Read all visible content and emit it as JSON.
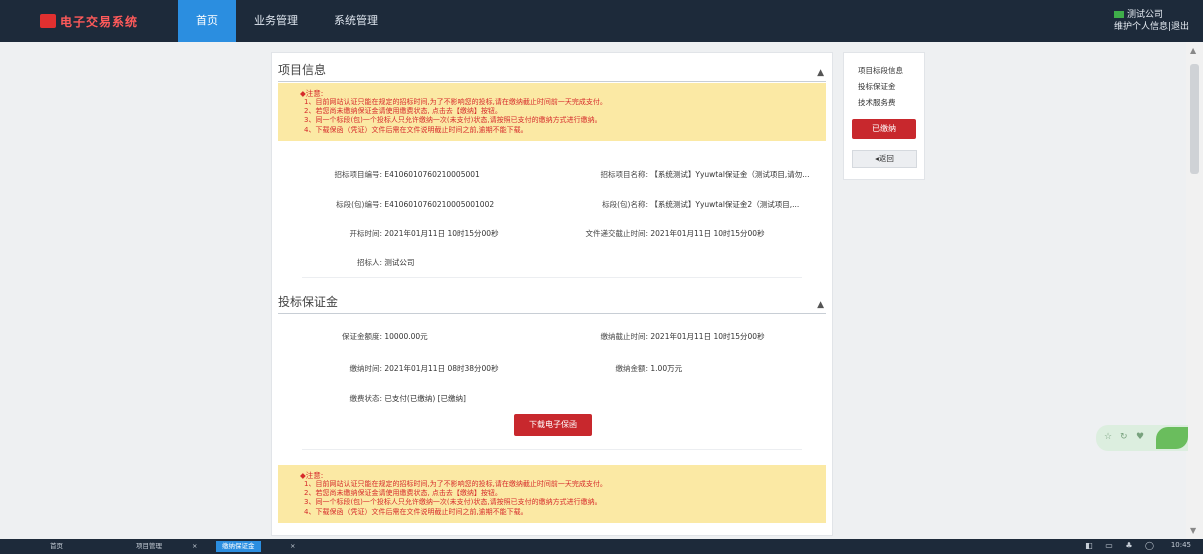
{
  "header": {
    "logo_text": "电子交易系统",
    "nav": [
      "首页",
      "业务管理",
      "系统管理"
    ],
    "user_line1": "测试公司",
    "user_line2": "维护个人信息|退出"
  },
  "section1": {
    "title": "项目信息",
    "toggle": "▲",
    "fields": {
      "tender_code_label": "招标项目编号:",
      "tender_code_value": "E4106010760210005001",
      "tender_name_label": "招标项目名称:",
      "tender_name_value": "【系统测试】Yyuwtal保证金（测试项目,请勿...",
      "section_code_label": "标段(包)编号:",
      "section_code_value": "E4106010760210005001002",
      "section_name_label": "标段(包)名称:",
      "section_name_value": "【系统测试】Yyuwtal保证金2（测试项目,...",
      "open_time_label": "开标时间:",
      "open_time_value": "2021年01月11日 10时15分00秒",
      "deadline_label": "文件递交截止时间:",
      "deadline_value": "2021年01月11日 10时15分00秒",
      "tenderer_label": "招标人:",
      "tenderer_value": "测试公司"
    }
  },
  "section2": {
    "title": "投标保证金",
    "toggle": "▲",
    "fields": {
      "amount_label": "保证金额度:",
      "amount_value": "10000.00元",
      "pay_deadline_label": "缴纳截止时间:",
      "pay_deadline_value": "2021年01月11日 10时15分00秒",
      "pay_time_label": "缴纳时间:",
      "pay_time_value": "2021年01月11日 08时38分00秒",
      "pay_amount_label": "缴纳金额:",
      "pay_amount_value": "1.00万元",
      "status_label": "缴费状态:",
      "status_value": "已支付(已缴纳) [已缴纳]"
    },
    "download_button": "下载电子保函"
  },
  "notice": {
    "title": "◆注意:",
    "lines": [
      "1、目前网站认证只能在规定的招标时间,为了不影响您的投标,请在缴纳截止时间前一天完成支付。",
      "2、若您尚未缴纳保证金请使用缴费状态, 点击去【缴纳】按钮。",
      "3、同一个标段(包)一个投标人只允许缴纳一次(未支付)状态,请按照已支付的缴纳方式进行缴纳。",
      "4、下载保函（凭证）文件后需在文件说明截止时间之前,逾期不能下载。"
    ]
  },
  "side": {
    "links": [
      "项目标段信息",
      "投标保证金",
      "技术服务费"
    ],
    "primary_button": "已缴纳",
    "back_button": "◂返回"
  },
  "float_widget": {
    "icons": [
      "☆",
      "↻",
      "♥"
    ]
  },
  "taskbar": {
    "items": [
      "首页",
      "项目管理",
      "缴纳保证金"
    ],
    "close_glyph": "×",
    "tray": "◧ ▭ ♣ ◯",
    "time": "10:45"
  }
}
